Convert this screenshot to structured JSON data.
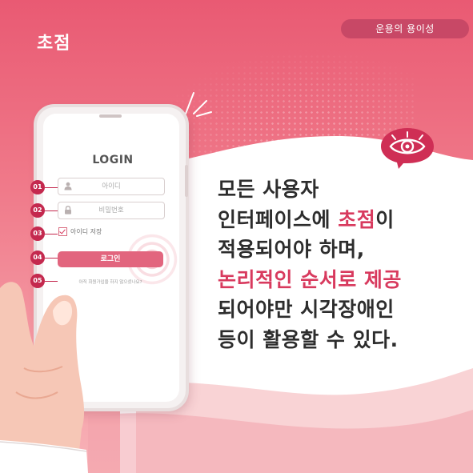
{
  "header": {
    "title": "초점",
    "badge": "운용의 용이성"
  },
  "phone": {
    "login_title": "LOGIN",
    "id_placeholder": "아이디",
    "password_placeholder": "비밀번호",
    "remember_label": "아이디 저장",
    "login_button": "로그인",
    "footer_text": "아직 회원가입을 하지 않으셨나요?",
    "steps": [
      "01",
      "02",
      "03",
      "04",
      "05"
    ]
  },
  "message": {
    "line1": "모든 사용자",
    "line2_pre": "인터페이스에 ",
    "line2_accent": "초점",
    "line2_post": "이",
    "line3": "적용되어야 하며,",
    "line4_accent": "논리적인 순서로 제공",
    "line5": "되어야만 시각장애인",
    "line6": "등이 활용할 수 있다."
  },
  "icons": {
    "eye": "eye-icon",
    "user": "user-icon",
    "lock": "lock-icon",
    "check": "checkbox-icon",
    "hand": "hand-illustration"
  },
  "colors": {
    "primary": "#e95a73",
    "accent": "#d83a5e",
    "badge": "#c84866",
    "text": "#2d2d2d"
  }
}
